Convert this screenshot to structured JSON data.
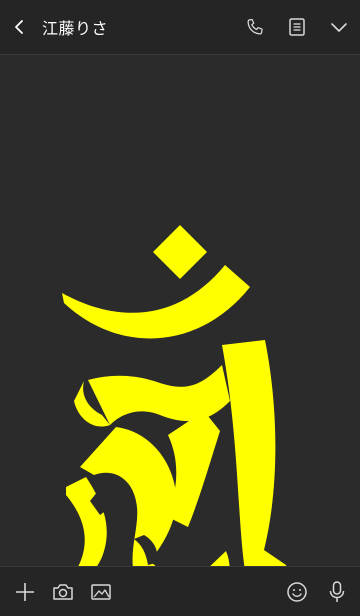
{
  "header": {
    "title": "江藤りさ"
  },
  "icons": {
    "back": "chevron-left-icon",
    "call": "phone-icon",
    "notes": "notes-icon",
    "menu": "chevron-down-icon",
    "add": "plus-icon",
    "camera": "camera-icon",
    "image": "image-icon",
    "emoji": "smiley-icon",
    "mic": "microphone-icon"
  },
  "colors": {
    "background": "#2b2b2b",
    "bar": "#252525",
    "icon": "#d9d9d9",
    "glyph": "#ffff00"
  }
}
